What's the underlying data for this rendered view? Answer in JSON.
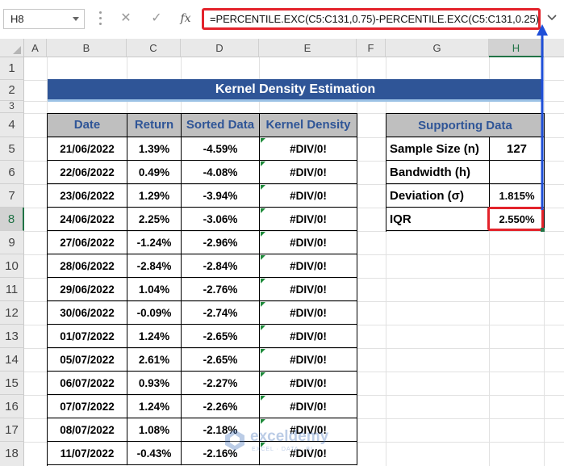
{
  "formula_bar": {
    "name_box": "H8",
    "cancel_icon": "✕",
    "enter_icon": "✓",
    "fx_label": "fx",
    "formula": "=PERCENTILE.EXC(C5:C131,0.75)-PERCENTILE.EXC(C5:C131,0.25)"
  },
  "columns": [
    "A",
    "B",
    "C",
    "D",
    "E",
    "F",
    "G",
    "H"
  ],
  "selected_column": "H",
  "rows": [
    "1",
    "2",
    "3",
    "4",
    "5",
    "6",
    "7",
    "8",
    "9",
    "10",
    "11",
    "12",
    "13",
    "14",
    "15",
    "16",
    "17",
    "18"
  ],
  "selected_row": "8",
  "title": "Kernel Density Estimation",
  "table": {
    "headers": [
      "Date",
      "Return",
      "Sorted Data",
      "Kernel Density"
    ],
    "rows": [
      [
        "21/06/2022",
        "1.39%",
        "-4.59%",
        "#DIV/0!"
      ],
      [
        "22/06/2022",
        "0.49%",
        "-4.08%",
        "#DIV/0!"
      ],
      [
        "23/06/2022",
        "1.29%",
        "-3.94%",
        "#DIV/0!"
      ],
      [
        "24/06/2022",
        "2.25%",
        "-3.06%",
        "#DIV/0!"
      ],
      [
        "27/06/2022",
        "-1.24%",
        "-2.96%",
        "#DIV/0!"
      ],
      [
        "28/06/2022",
        "-2.84%",
        "-2.84%",
        "#DIV/0!"
      ],
      [
        "29/06/2022",
        "1.04%",
        "-2.76%",
        "#DIV/0!"
      ],
      [
        "30/06/2022",
        "-0.09%",
        "-2.74%",
        "#DIV/0!"
      ],
      [
        "01/07/2022",
        "1.24%",
        "-2.65%",
        "#DIV/0!"
      ],
      [
        "05/07/2022",
        "2.61%",
        "-2.65%",
        "#DIV/0!"
      ],
      [
        "06/07/2022",
        "0.93%",
        "-2.27%",
        "#DIV/0!"
      ],
      [
        "07/07/2022",
        "1.24%",
        "-2.26%",
        "#DIV/0!"
      ],
      [
        "08/07/2022",
        "1.08%",
        "-2.18%",
        "#DIV/0!"
      ],
      [
        "11/07/2022",
        "-0.43%",
        "-2.16%",
        "#DIV/0!"
      ]
    ]
  },
  "supporting": {
    "header": "Supporting Data",
    "items": [
      {
        "label": "Sample Size (n)",
        "value": "127"
      },
      {
        "label": "Bandwidth (h)",
        "value": ""
      },
      {
        "label": "Deviation (σ)",
        "value": "1.815%"
      },
      {
        "label": "IQR",
        "value": "2.550%"
      }
    ]
  },
  "watermark": {
    "name": "exceldemy",
    "tagline": "EXCEL · DATA · BI"
  },
  "colors": {
    "title_band": "#2f5597",
    "header_fill": "#bfbfbf",
    "header_text": "#2f5597",
    "highlight": "#e3232b",
    "arrow": "#1f4fd8",
    "selection": "#217346"
  }
}
